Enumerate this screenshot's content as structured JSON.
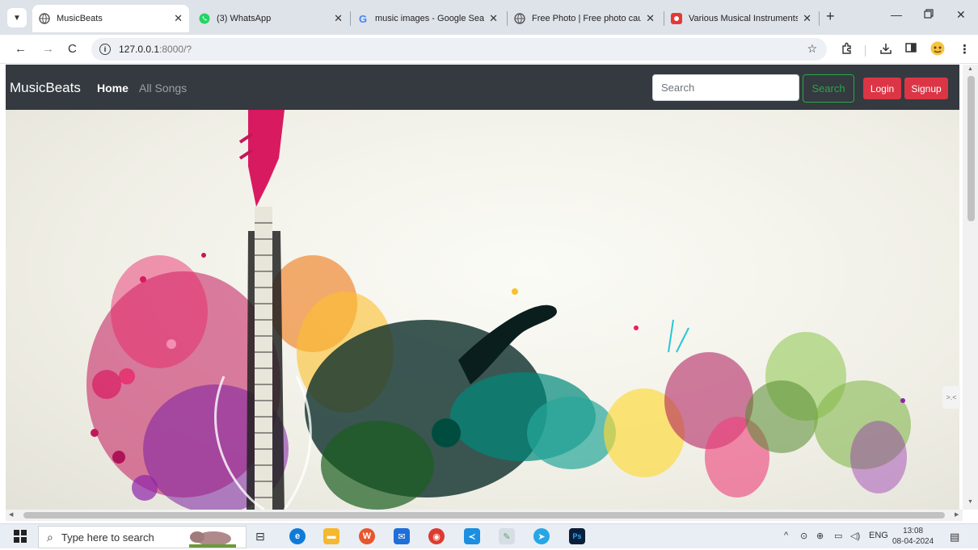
{
  "browser": {
    "tabs": [
      {
        "title": "MusicBeats",
        "active": true,
        "icon": "globe-icon"
      },
      {
        "title": "(3) WhatsApp",
        "active": false,
        "icon": "whatsapp-icon"
      },
      {
        "title": "music images - Google Sear",
        "active": false,
        "icon": "google-icon"
      },
      {
        "title": "Free Photo | Free photo cau",
        "active": false,
        "icon": "globe-icon"
      },
      {
        "title": "Various Musical Instruments",
        "active": false,
        "icon": "red-site-icon"
      }
    ],
    "new_tab": "+",
    "url_host": "127.0.0.1",
    "url_path": ":8000/?"
  },
  "site": {
    "brand": "MusicBeats",
    "nav": {
      "home": "Home",
      "all_songs": "All Songs"
    },
    "search": {
      "placeholder": "Search",
      "button": "Search"
    },
    "login": "Login",
    "signup": "Signup"
  },
  "taskbar": {
    "search_placeholder": "Type here to search",
    "lang": "ENG",
    "time": "13:08",
    "date": "08-04-2024"
  },
  "colors": {
    "navbar_bg": "#343a40",
    "accent_red": "#dc3545",
    "accent_green": "#28a745"
  }
}
